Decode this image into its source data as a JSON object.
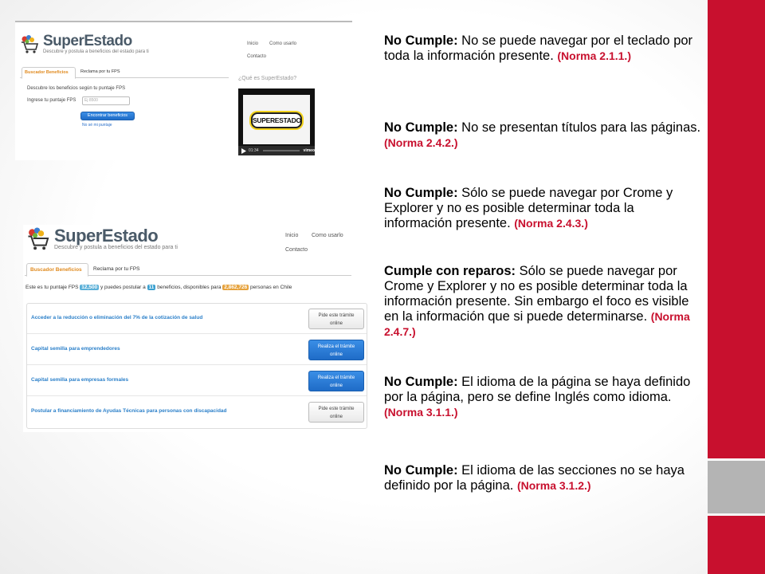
{
  "accent_colors": {
    "primary": "#c8102e",
    "secondary": "#b4b4b4",
    "link_blue": "#2a7fc9",
    "button_blue": "#1f6cc7"
  },
  "screenshot1": {
    "logo": {
      "title": "SuperEstado",
      "subtitle": "Descubre y postula a beneficios del estado para ti"
    },
    "nav": {
      "inicio": "Inicio",
      "como_usarlo": "Como usarlo",
      "contacto": "Contacto"
    },
    "tabs": [
      {
        "label": "Buscador Beneficios",
        "active": true
      },
      {
        "label": "Reclama por tu FPS",
        "active": false
      }
    ],
    "form": {
      "intro": "Descubre los beneficios según tu puntaje FPS",
      "label": "Ingrese tu puntaje FPS",
      "placeholder": "Ej 8500",
      "button": "Encontrar beneficios",
      "link": "No sé mi puntaje"
    },
    "aside_title": "¿Qué es SuperEstado?",
    "video": {
      "title_art": "SUPERESTADO",
      "time": "01:34",
      "brand": "vimeo",
      "icon": "play-icon"
    }
  },
  "screenshot2": {
    "logo": {
      "title": "SuperEstado",
      "subtitle": "Descubre y postula a beneficios del estado para ti"
    },
    "nav": {
      "inicio": "Inicio",
      "como_usarlo": "Como usarlo",
      "contacto": "Contacto"
    },
    "tabs": [
      {
        "label": "Buscador Beneficios",
        "active": true
      },
      {
        "label": "Reclama por tu FPS",
        "active": false
      }
    ],
    "summary": {
      "part1": "Este es tu puntaje FPS",
      "score": "12,500",
      "part2": "y puedes postular a",
      "count": "11",
      "part3": "beneficios, disponibles para",
      "people": "2,862,726",
      "part4": "personas en Chile"
    },
    "benefits": [
      {
        "label": "Acceder a la reducción o eliminación del 7% de la cotización de salud",
        "button_line1": "Pide este trámite",
        "button_line2": "online",
        "style": "white"
      },
      {
        "label": "Capital semilla para emprendedores",
        "button_line1": "Realiza el trámite",
        "button_line2": "online",
        "style": "blue"
      },
      {
        "label": "Capital semilla para empresas formales",
        "button_line1": "Realiza el trámite",
        "button_line2": "online",
        "style": "blue"
      },
      {
        "label": "Postular a financiamiento de Ayudas Técnicas para personas con discapacidad",
        "button_line1": "Pide este trámite",
        "button_line2": "online",
        "style": "white"
      }
    ]
  },
  "findings": [
    {
      "lead": "No Cumple:",
      "text": " No se puede navegar por el teclado por toda la información presente.",
      "norm": "(Norma 2.1.1.)"
    },
    {
      "lead": "No Cumple:",
      "text": " No se presentan títulos para las páginas. ",
      "norm": "(Norma 2.4.2.)"
    },
    {
      "lead": "No Cumple:",
      "text": " Sólo se puede navegar por Crome y Explorer y no es posible determinar toda la información presente. ",
      "norm": "(Norma 2.4.3.)"
    },
    {
      "lead": "Cumple con reparos:",
      "text": " Sólo se puede navegar por Crome y Explorer y no es posible determinar toda la información presente. Sin embargo el foco es visible en la información que si puede determinarse. ",
      "norm": "(Norma 2.4.7.)"
    },
    {
      "lead": "No Cumple:",
      "text": " El idioma de la página se haya definido por la página, pero se define Inglés como idioma. ",
      "norm": "(Norma 3.1.1.)"
    },
    {
      "lead": "No Cumple:",
      "text": " El idioma de las secciones no se haya definido por la página. ",
      "norm": "(Norma 3.1.2.)"
    }
  ]
}
